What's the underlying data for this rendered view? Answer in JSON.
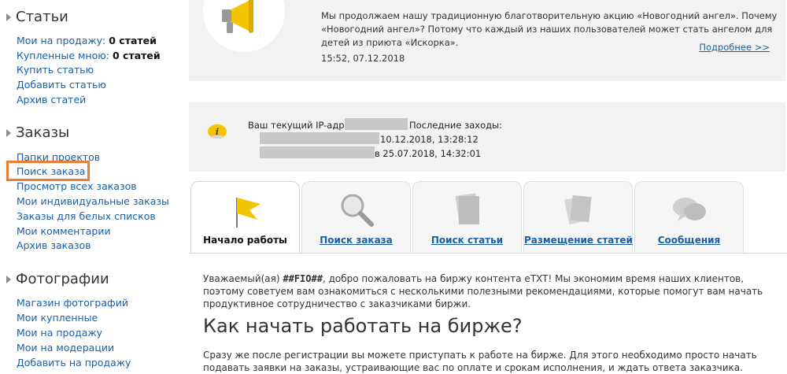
{
  "sidebar": {
    "articles": {
      "title": "Статьи",
      "items": [
        {
          "label": "Мои на продажу:",
          "count": "0 статей"
        },
        {
          "label": "Купленные мною:",
          "count": "0 статей"
        },
        {
          "label": "Купить статью"
        },
        {
          "label": "Добавить статью"
        },
        {
          "label": "Архив статей"
        }
      ]
    },
    "orders": {
      "title": "Заказы",
      "items": [
        {
          "label": "Папки проектов"
        },
        {
          "label": "Поиск заказа"
        },
        {
          "label": "Просмотр всех заказов"
        },
        {
          "label": "Мои индивидуальные заказы"
        },
        {
          "label": "Заказы для белых списков"
        },
        {
          "label": "Мои комментарии"
        },
        {
          "label": "Архив заказов"
        }
      ]
    },
    "photos": {
      "title": "Фотографии",
      "items": [
        {
          "label": "Магазин фотографий"
        },
        {
          "label": "Мои купленные"
        },
        {
          "label": "Мои на продажу"
        },
        {
          "label": "Мои на модерации"
        },
        {
          "label": "Добавить на продажу"
        }
      ]
    }
  },
  "news": {
    "text": "Мы продолжаем нашу традиционную благотворительную акцию «Новогодний ангел». Почему «Новогодний ангел»? Потому что каждый из наших пользователей может стать ангелом для детей из приюта «Искорка».",
    "time": "15:52, 07.12.2018",
    "more": "Подробнее >>"
  },
  "ip": {
    "current_label": "Ваш текущий IP-адрес:",
    "last_label": "Последние заходы:",
    "visit1": "10.12.2018, 13:28:12",
    "visit2": "в 25.07.2018, 14:32:01"
  },
  "tabs": [
    {
      "label": "Начало работы",
      "icon": "flag-icon",
      "active": true
    },
    {
      "label": "Поиск заказа",
      "icon": "magnifier-icon",
      "active": false
    },
    {
      "label": "Поиск статьи",
      "icon": "document-icon",
      "active": false
    },
    {
      "label": "Размещение статей",
      "icon": "papers-icon",
      "active": false
    },
    {
      "label": "Сообщения",
      "icon": "chat-bubbles-icon",
      "active": false
    }
  ],
  "content": {
    "welcome_prefix": "Уважаемый(ая) ",
    "welcome_name": "##FIO##",
    "welcome_rest": ", добро пожаловать на биржу контента eTXT! Мы экономим время наших клиентов, поэтому советуем вам ознакомиться с несколькими полезными рекомендациями, которые помогут вам начать продуктивное сотрудничество с заказчиками биржи.",
    "heading": "Как начать работать на бирже?",
    "paragraph": "Сразу же после регистрации вы можете приступать к работе на бирже. Для этого необходимо просто начать подавать заявки на заказы, устраивающие вас по оплате и срокам исполнения, и ждать ответа заказчика."
  },
  "colors": {
    "link": "#1a5fa8",
    "highlight": "#ef7d2f",
    "panel": "#f2f2f2",
    "accent_yellow": "#f5c400"
  }
}
